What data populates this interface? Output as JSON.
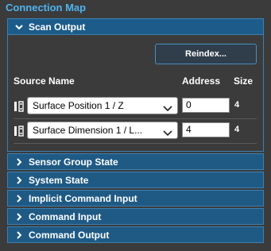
{
  "panel": {
    "title": "Connection Map"
  },
  "scan_output": {
    "label": "Scan Output",
    "reindex_label": "Reindex...",
    "columns": {
      "source_name": "Source Name",
      "address": "Address",
      "size": "Size"
    },
    "rows": [
      {
        "source": "Surface Position 1 / Z",
        "address": "0",
        "size": "4"
      },
      {
        "source": "Surface Dimension 1 / L...",
        "address": "4",
        "size": "4"
      }
    ]
  },
  "sections": [
    {
      "label": "Sensor Group State"
    },
    {
      "label": "System State"
    },
    {
      "label": "Implicit Command Input"
    },
    {
      "label": "Command Input"
    },
    {
      "label": "Command Output"
    }
  ],
  "icons": {
    "expanded": "chevron-down-icon",
    "collapsed": "chevron-right-icon",
    "mapping": "io-mapping-icon",
    "dropdown": "chevron-down-icon"
  },
  "colors": {
    "accent": "#4fb3f0",
    "header_bg": "#1f5a85",
    "header_border": "#3e7fb0",
    "background": "#3b3b3b"
  }
}
